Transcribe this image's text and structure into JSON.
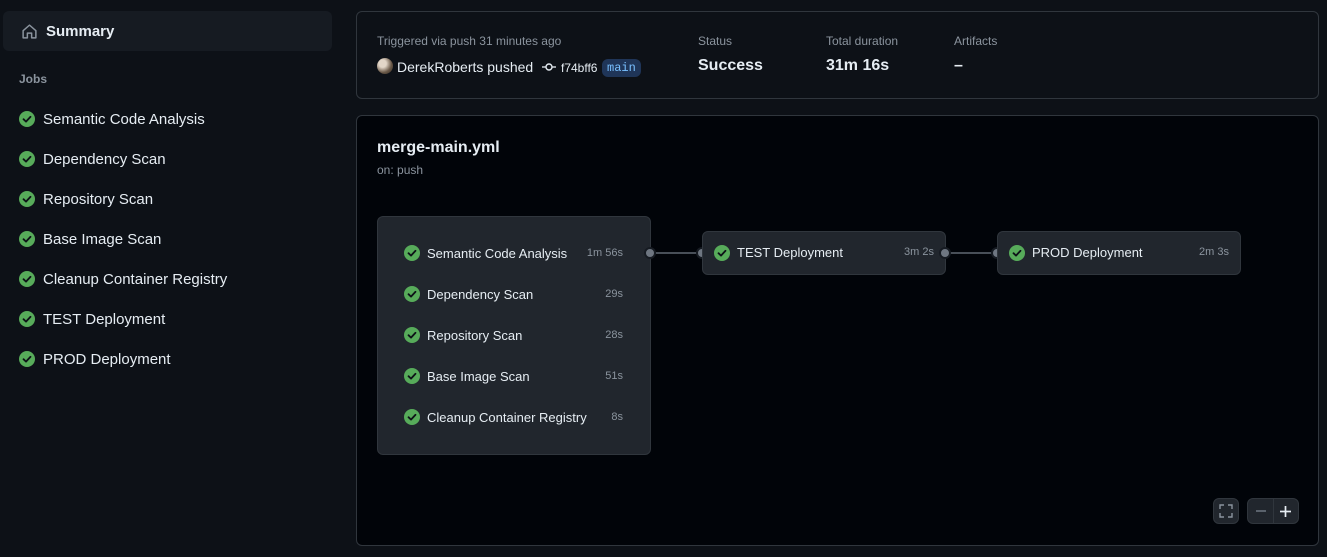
{
  "sidebar": {
    "summary_label": "Summary",
    "jobs_heading": "Jobs",
    "jobs": [
      {
        "label": "Semantic Code Analysis",
        "status": "success"
      },
      {
        "label": "Dependency Scan",
        "status": "success"
      },
      {
        "label": "Repository Scan",
        "status": "success"
      },
      {
        "label": "Base Image Scan",
        "status": "success"
      },
      {
        "label": "Cleanup Container Registry",
        "status": "success"
      },
      {
        "label": "TEST Deployment",
        "status": "success"
      },
      {
        "label": "PROD Deployment",
        "status": "success"
      }
    ]
  },
  "run_summary": {
    "trigger_text": "Triggered via push 31 minutes ago",
    "actor_text": "DerekRoberts pushed",
    "commit_sha": "f74bff6",
    "branch": "main",
    "status_label": "Status",
    "status_value": "Success",
    "duration_label": "Total duration",
    "duration_value": "31m 16s",
    "artifacts_label": "Artifacts",
    "artifacts_value": "–"
  },
  "workflow": {
    "file": "merge-main.yml",
    "trigger": "on: push",
    "group_jobs": [
      {
        "name": "Semantic Code Analysis",
        "duration": "1m 56s"
      },
      {
        "name": "Dependency Scan",
        "duration": "29s"
      },
      {
        "name": "Repository Scan",
        "duration": "28s"
      },
      {
        "name": "Base Image Scan",
        "duration": "51s"
      },
      {
        "name": "Cleanup Container Registry",
        "duration": "8s"
      }
    ],
    "test_job": {
      "name": "TEST Deployment",
      "duration": "3m 2s"
    },
    "prod_job": {
      "name": "PROD Deployment",
      "duration": "2m 3s"
    }
  },
  "colors": {
    "success": "#57ab5a",
    "background": "#0d1117",
    "branch_bg": "#1f3558",
    "branch_fg": "#79c0ff"
  },
  "icons": {
    "summary": "home-icon",
    "job_status": "check-circle-icon",
    "commit": "git-commit-icon",
    "fullscreen": "fullscreen-icon",
    "zoom_out": "minus-icon",
    "zoom_in": "plus-icon"
  }
}
